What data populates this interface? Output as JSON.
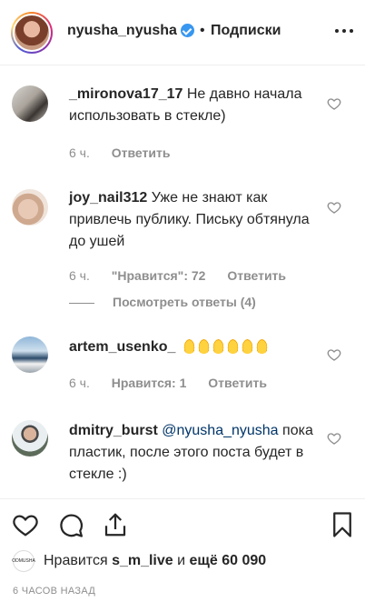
{
  "header": {
    "username": "nyusha_nyusha",
    "separator": "•",
    "follow_label": "Подписки"
  },
  "comments": [
    {
      "username": "_mironova17_17",
      "text": "Не давно начала использовать в стекле)",
      "time": "6 ч.",
      "reply_label": "Ответить"
    },
    {
      "username": "joy_nail312",
      "text": "Уже не знают как привлечь публику. Письку обтянула до ушей",
      "time": "6 ч.",
      "likes_label": "\"Нравится\": 72",
      "reply_label": "Ответить",
      "view_replies_label": "Посмотреть ответы (4)"
    },
    {
      "username": "artem_usenko_",
      "text": "",
      "emoji_count": 6,
      "time": "6 ч.",
      "likes_label": "Нравится: 1",
      "reply_label": "Ответить"
    },
    {
      "username": "dmitry_burst",
      "mention": "@nyusha_nyusha",
      "text": "пока пластик, после этого поста будет в стекле :)"
    }
  ],
  "likes": {
    "avatar_text": "ODMUSHA",
    "prefix": "Нравится",
    "user": "s_m_live",
    "middle": "и",
    "others": "ещё 60 090"
  },
  "timestamp": "6 ЧАСОВ НАЗАД"
}
